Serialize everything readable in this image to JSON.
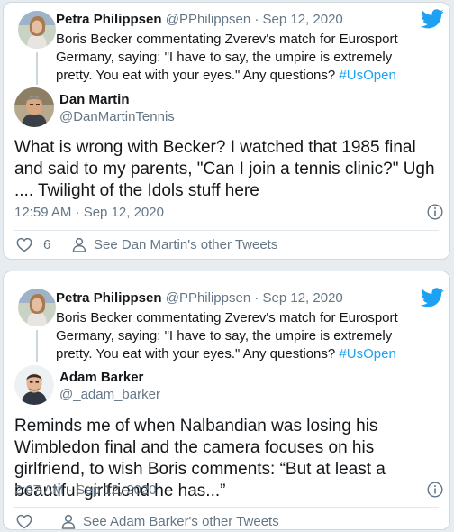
{
  "colors": {
    "accent": "#1da1f2",
    "muted": "#657786",
    "text": "#14171a"
  },
  "icons": {
    "logo": "twitter-bird-icon",
    "info": "info-circle-icon",
    "like": "heart-icon",
    "profile": "person-icon"
  },
  "tweets": [
    {
      "quoted": {
        "name": "Petra Philippsen",
        "handle": "@PPhilippsen",
        "sep": "·",
        "date": "Sep 12, 2020",
        "text": "Boris Becker commentating Zverev's match for Eurosport Germany, saying: \"I have to say, the umpire is extremely pretty. You eat with your eyes.\" Any questions?",
        "hashtag": "#UsOpen"
      },
      "author": {
        "name": "Dan Martin",
        "handle": "@DanMartinTennis"
      },
      "text": "What is wrong with Becker?  I watched that 1985 final and said to my parents, \"Can I join a tennis clinic?\"  Ugh .... Twilight of the Idols stuff here",
      "timestamp": "12:59 AM · Sep 12, 2020",
      "likes": "6",
      "other_tweets": "See Dan Martin's other Tweets"
    },
    {
      "quoted": {
        "name": "Petra Philippsen",
        "handle": "@PPhilippsen",
        "sep": "·",
        "date": "Sep 12, 2020",
        "text": "Boris Becker commentating Zverev's match for Eurosport Germany, saying: \"I have to say, the umpire is extremely pretty. You eat with your eyes.\" Any questions?",
        "hashtag": "#UsOpen"
      },
      "author": {
        "name": "Adam Barker",
        "handle": "@_adam_barker"
      },
      "text": "Reminds me of when Nalbandian was losing his Wimbledon final and the camera focuses on his girlfriend, to wish Boris comments: “But at least a beautiful girlfriend he has...”",
      "timestamp": "2:07 AM · Sep 12, 2020",
      "likes": "",
      "other_tweets": "See Adam Barker's other Tweets"
    }
  ]
}
